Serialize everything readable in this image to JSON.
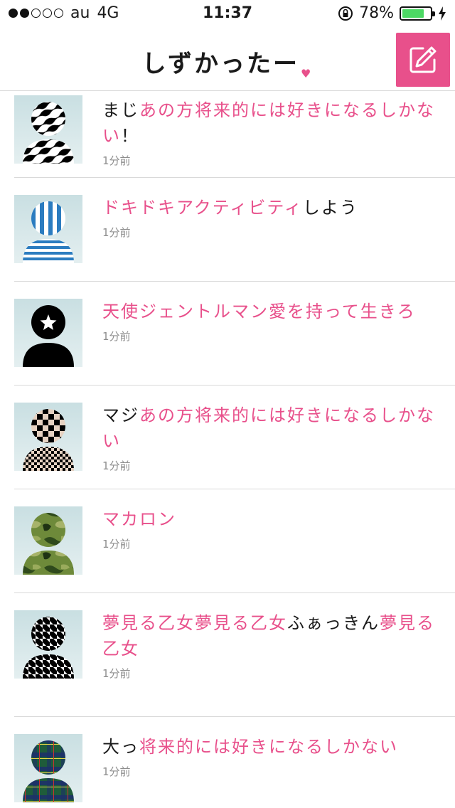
{
  "status_bar": {
    "carrier": "au",
    "network": "4G",
    "time": "11:37",
    "battery_percent": "78%",
    "battery_level": 0.78,
    "signal_bars_filled": 2,
    "signal_bars_total": 5,
    "battery_color": "#4cd964"
  },
  "nav": {
    "title": "しずかったー",
    "title_heart": "♥",
    "compose_icon": "compose-pencil-icon",
    "accent_color": "#e8508b"
  },
  "posts": [
    {
      "avatar_pattern": "zebra",
      "segments": [
        {
          "text": "まじ",
          "hl": false
        },
        {
          "text": "あの方将来的には好きになるしかない",
          "hl": true
        },
        {
          "text": "！",
          "hl": false
        }
      ],
      "time": "1分前"
    },
    {
      "avatar_pattern": "blue-stripes",
      "segments": [
        {
          "text": "ドキドキアクティビティ",
          "hl": true
        },
        {
          "text": "しよう",
          "hl": false
        }
      ],
      "time": "1分前"
    },
    {
      "avatar_pattern": "black-star",
      "segments": [
        {
          "text": "天使ジェントルマン愛を持って生きろ",
          "hl": true
        }
      ],
      "time": "1分前"
    },
    {
      "avatar_pattern": "checkered",
      "segments": [
        {
          "text": "マジ",
          "hl": false
        },
        {
          "text": "あの方将来的には好きになるしかない",
          "hl": true
        }
      ],
      "time": "1分前"
    },
    {
      "avatar_pattern": "camouflage",
      "segments": [
        {
          "text": "マカロン",
          "hl": true
        }
      ],
      "time": "1分前"
    },
    {
      "avatar_pattern": "houndstooth",
      "segments": [
        {
          "text": "夢見る乙女夢見る乙女",
          "hl": true
        },
        {
          "text": "ふぁっきん",
          "hl": false
        },
        {
          "text": "夢見る乙女",
          "hl": true
        }
      ],
      "time": "1分前"
    },
    {
      "avatar_pattern": "tartan",
      "segments": [
        {
          "text": "大っ",
          "hl": false
        },
        {
          "text": "将来的には好きになるしかない",
          "hl": true
        }
      ],
      "time": "1分前"
    }
  ]
}
